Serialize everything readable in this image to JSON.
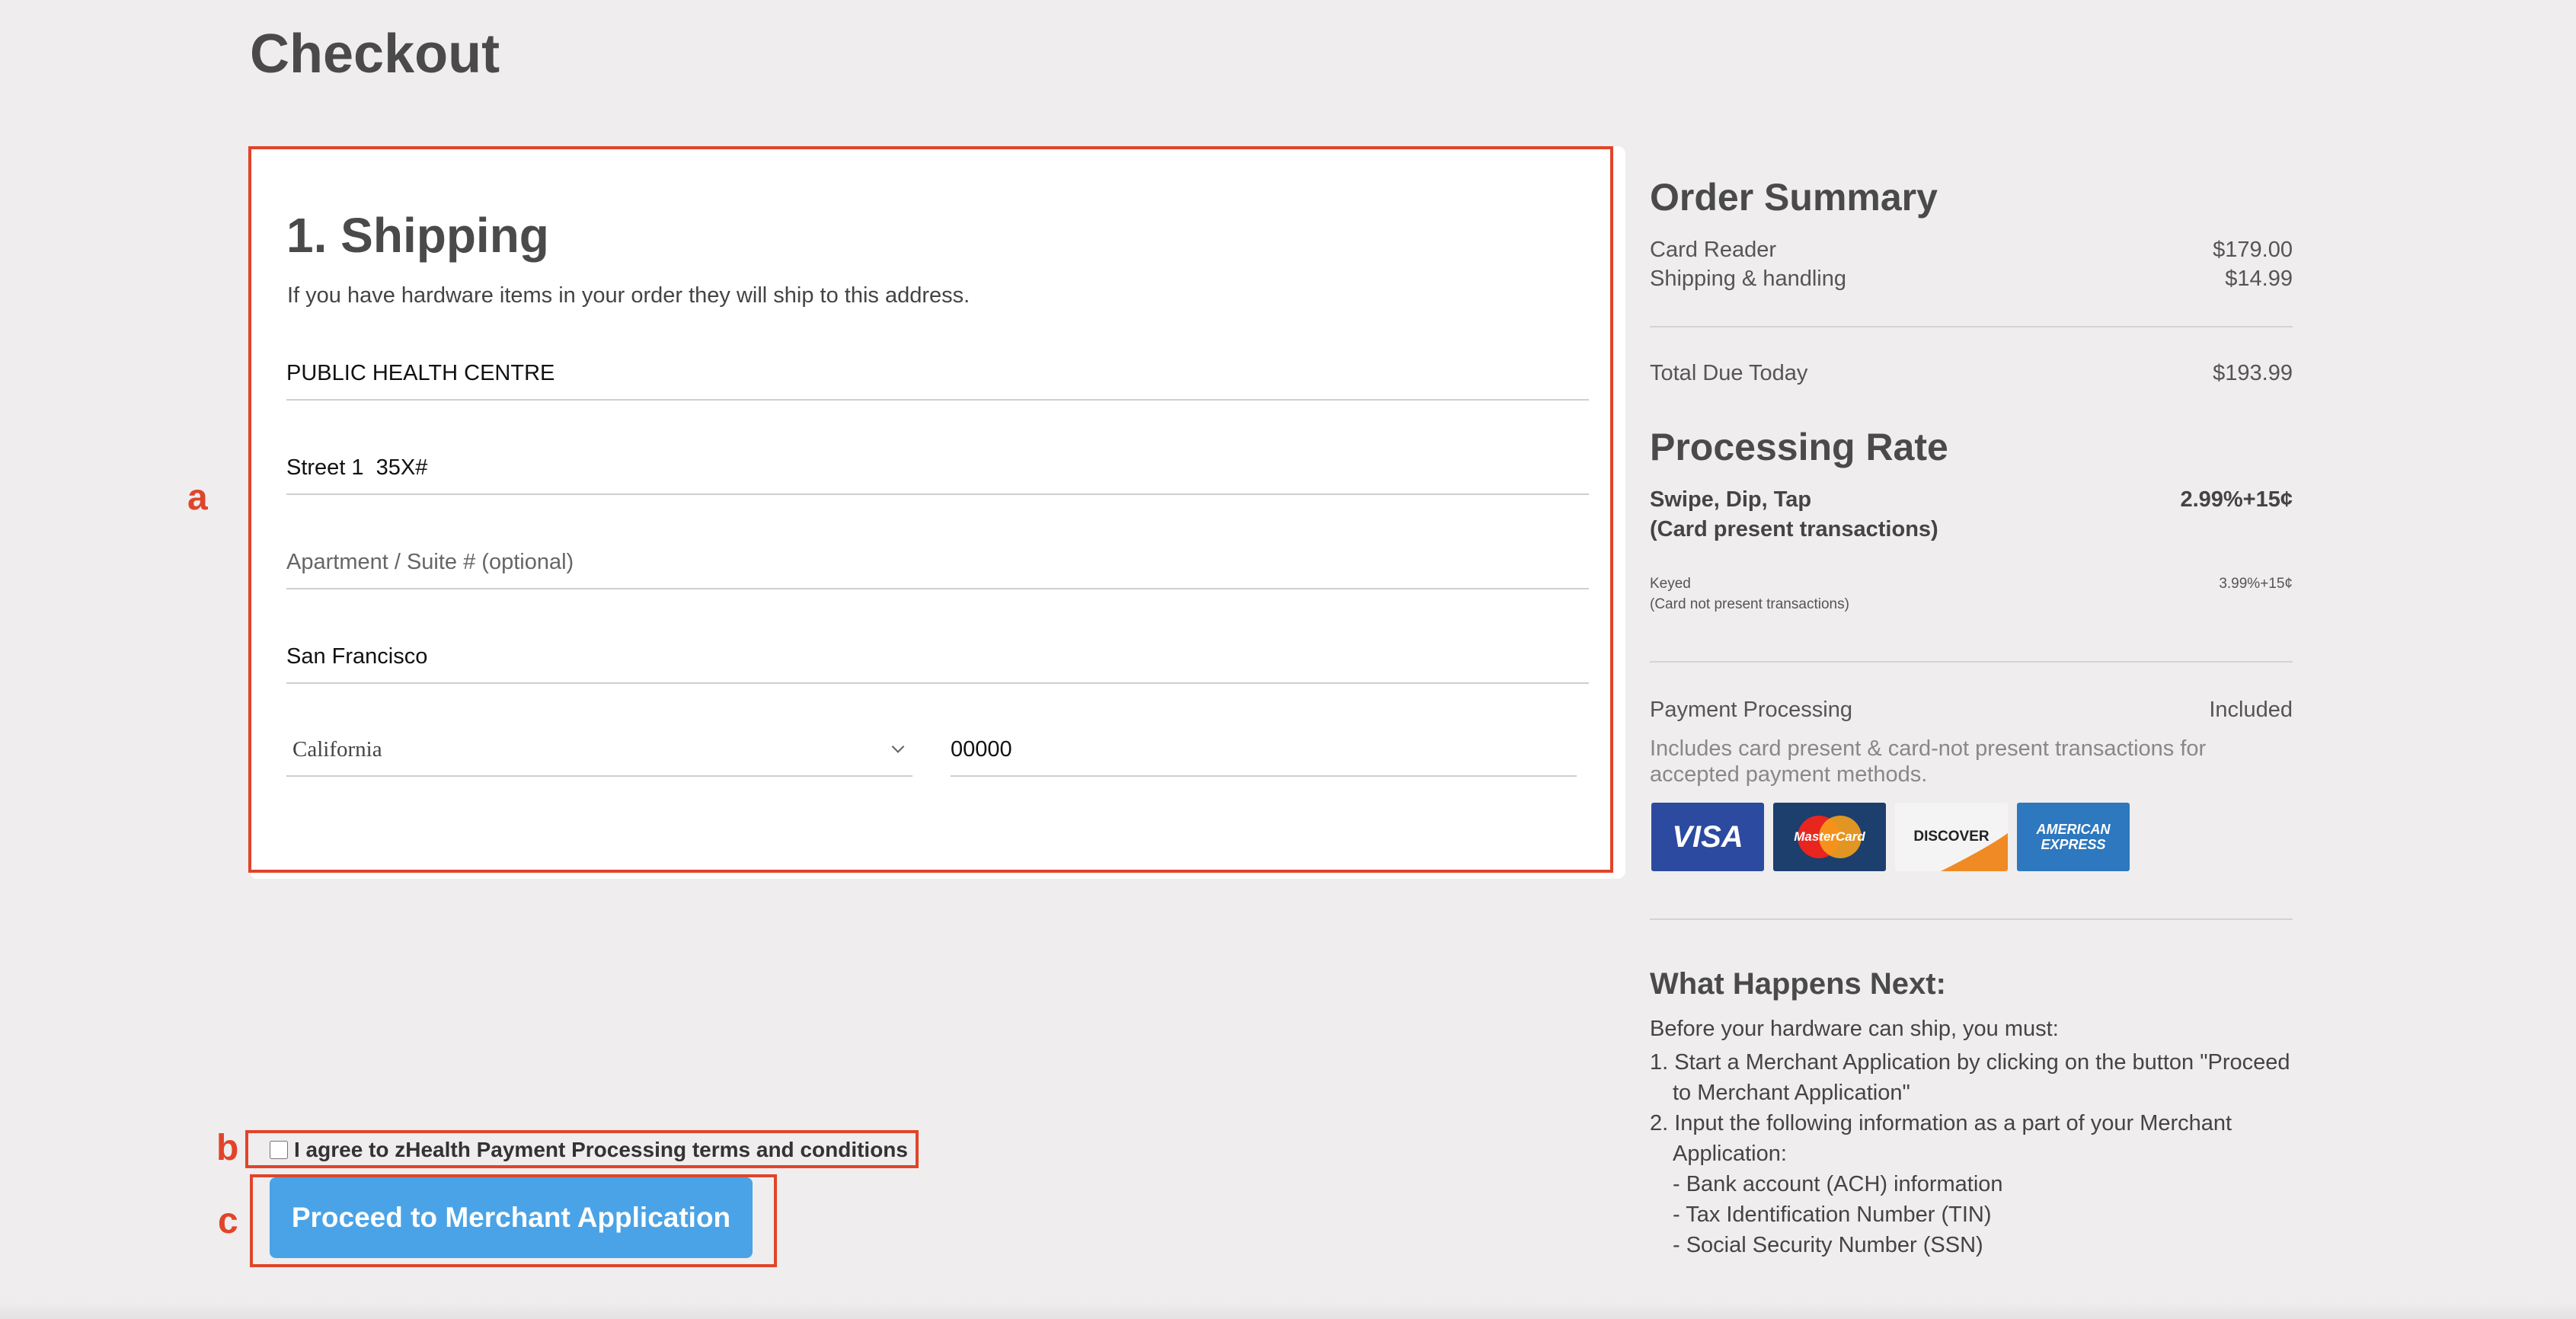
{
  "page": {
    "title": "Checkout"
  },
  "shipping": {
    "title": "1. Shipping",
    "subtitle": "If you have hardware items in your order they will ship to this address.",
    "fields": {
      "name": {
        "value": "PUBLIC HEALTH CENTRE"
      },
      "street": {
        "value": "Street 1  35X#"
      },
      "apartment": {
        "value": "",
        "placeholder": "Apartment / Suite # (optional)"
      },
      "city": {
        "value": "San Francisco"
      },
      "state": {
        "value": "California"
      },
      "zip": {
        "value": "00000"
      }
    }
  },
  "annotations": {
    "a": "a",
    "b": "b",
    "c": "c"
  },
  "order_summary": {
    "title": "Order Summary",
    "items": [
      {
        "label": "Card Reader",
        "amount": "$179.00"
      },
      {
        "label": "Shipping & handling",
        "amount": "$14.99"
      }
    ],
    "total": {
      "label": "Total Due Today",
      "amount": "$193.99"
    }
  },
  "processing_rate": {
    "title": "Processing Rate",
    "swipe": {
      "label_line1": "Swipe, Dip, Tap",
      "label_line2": "(Card present transactions)",
      "rate": "2.99%+15¢"
    },
    "keyed": {
      "label_line1": "Keyed",
      "label_line2": "(Card not present transactions)",
      "rate": "3.99%+15¢"
    },
    "payment_processing": {
      "label": "Payment Processing",
      "value": "Included"
    },
    "note": "Includes card present & card-not present transactions for accepted payment methods.",
    "card_logos": [
      {
        "name": "VISA",
        "color": "#2b4aa0"
      },
      {
        "name": "MasterCard",
        "color": "#1c3f6e"
      },
      {
        "name": "DISCOVER",
        "color": "#f4f4f4"
      },
      {
        "name": "AMERICAN EXPRESS",
        "color": "#2d78bf"
      }
    ]
  },
  "next_steps": {
    "title": "What Happens Next:",
    "intro": "Before your hardware can ship, you must:",
    "step1_line1": "1. Start a Merchant Application by clicking on the button \"Proceed",
    "step1_line2": "to Merchant Application\"",
    "step2_line1": "2. Input the following information as a part of your Merchant",
    "step2_line2": "Application:",
    "sub1": "- Bank account (ACH) information",
    "sub2": "- Tax Identification Number (TIN)",
    "sub3": "- Social Security Number (SSN)"
  },
  "actions": {
    "terms_label": "I agree to zHealth Payment Processing terms and conditions",
    "proceed_label": "Proceed to Merchant Application"
  }
}
